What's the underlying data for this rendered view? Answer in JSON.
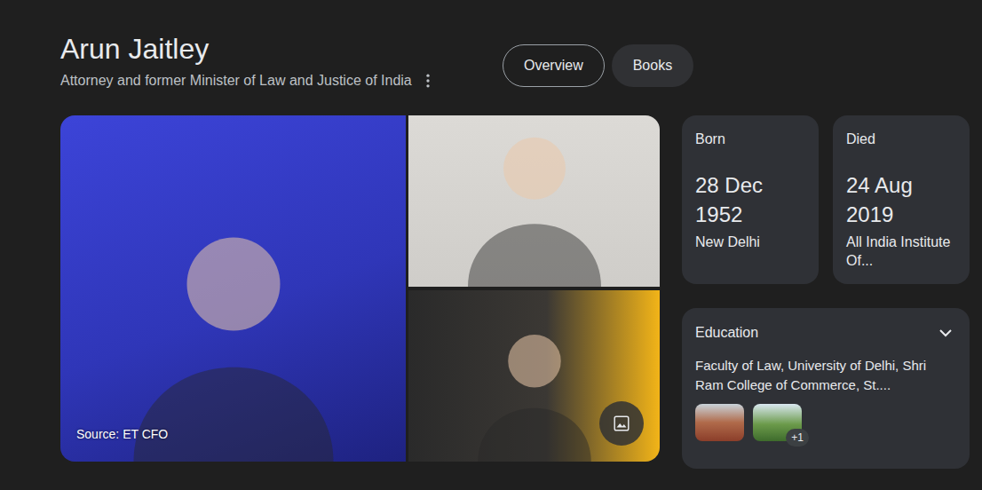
{
  "title": "Arun Jaitley",
  "subtitle": "Attorney and former Minister of Law and Justice of India",
  "tabs": [
    {
      "label": "Overview",
      "selected": true
    },
    {
      "label": "Books",
      "selected": false
    }
  ],
  "images": {
    "source": "Source: ET CFO"
  },
  "facts": [
    {
      "label": "Born",
      "value": "28 Dec 1952",
      "detail": "New Delhi"
    },
    {
      "label": "Died",
      "value": "24 Aug 2019",
      "detail": "All India Institute Of..."
    }
  ],
  "education": {
    "label": "Education",
    "expanded": false,
    "text": "Faculty of Law, University of Delhi, Shri Ram College of Commerce, St....",
    "more_count": "+1"
  }
}
